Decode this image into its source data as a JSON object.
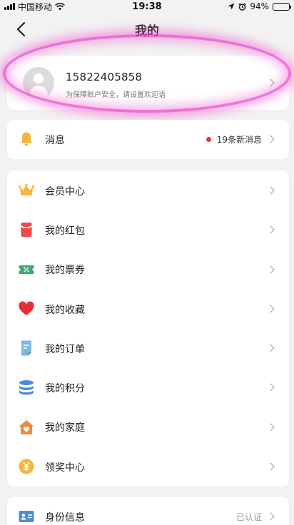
{
  "status_bar": {
    "carrier": "中国移动",
    "time": "19:38",
    "battery": "94%",
    "battery_level": 0.94
  },
  "nav": {
    "title": "我的"
  },
  "profile": {
    "phone": "15822405858",
    "hint": "为保障账户安全，请设置欢迎语"
  },
  "messages": {
    "label": "消息",
    "badge": "19条新消息"
  },
  "menu": [
    {
      "label": "会员中心",
      "icon": "crown-icon",
      "color": "#f6b73c"
    },
    {
      "label": "我的红包",
      "icon": "red-envelope-icon",
      "color": "#ee4b4b"
    },
    {
      "label": "我的票券",
      "icon": "coupon-icon",
      "color": "#3fa96b"
    },
    {
      "label": "我的收藏",
      "icon": "heart-icon",
      "color": "#e62e3a"
    },
    {
      "label": "我的订单",
      "icon": "order-icon",
      "color": "#5aa6d8"
    },
    {
      "label": "我的积分",
      "icon": "points-stack-icon",
      "color": "#4a8fd6"
    },
    {
      "label": "我的家庭",
      "icon": "home-icon",
      "color": "#f08a3c"
    },
    {
      "label": "领奖中心",
      "icon": "yen-coin-icon",
      "color": "#f5b43a"
    }
  ],
  "identity": {
    "label": "身份信息",
    "status": "已认证"
  }
}
